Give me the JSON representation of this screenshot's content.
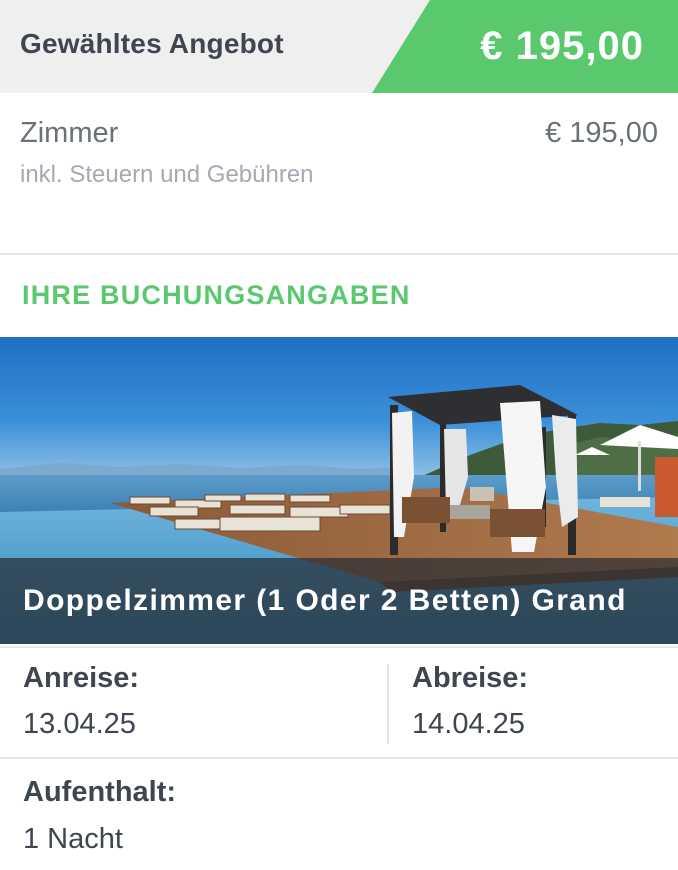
{
  "offer": {
    "title": "Gewähltes Angebot",
    "total_price": "€ 195,00",
    "accent_color": "#5ac96e"
  },
  "room": {
    "label": "Zimmer",
    "price": "€ 195,00",
    "note": "inkl. Steuern und Gebühren"
  },
  "booking": {
    "heading": "IHRE BUCHUNGSANGABEN",
    "room_name": "Doppelzimmer (1 Oder 2 Betten) Grand",
    "arrival_label": "Anreise:",
    "arrival_date": "13.04.25",
    "departure_label": "Abreise:",
    "departure_date": "14.04.25",
    "stay_label": "Aufenthalt:",
    "stay_value": "1 Nacht"
  }
}
